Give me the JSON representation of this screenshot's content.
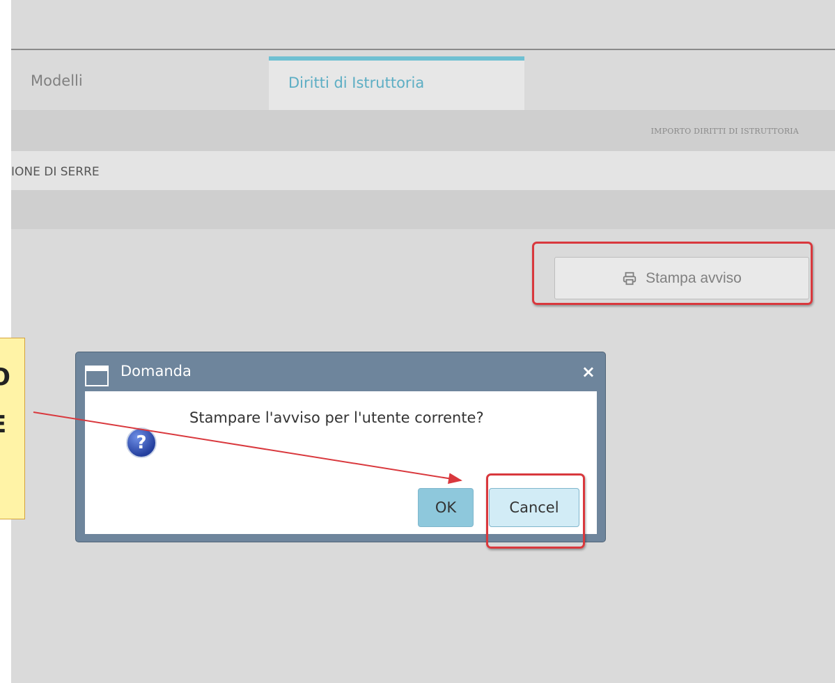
{
  "tabs": {
    "tab1": "Modelli",
    "tab2": "Diritti di Istruttoria"
  },
  "header_band": {
    "label": "IMPORTO DIRITTI DI ISTRUTTORIA"
  },
  "row": {
    "text": "IONE DI SERRE"
  },
  "print_button": {
    "label": "Stampa avviso",
    "icon": "printer-icon"
  },
  "dialog": {
    "title": "Domanda",
    "message": "Stampare l'avviso per l'utente corrente?",
    "ok_label": "OK",
    "cancel_label": "Cancel",
    "close_symbol": "×",
    "question_symbol": "?"
  },
  "callout": {
    "line1": "O",
    "line2": "E"
  },
  "colors": {
    "tab_accent": "#6fc0d2",
    "highlight": "#d9383d",
    "dialog_frame": "#6e859c"
  }
}
